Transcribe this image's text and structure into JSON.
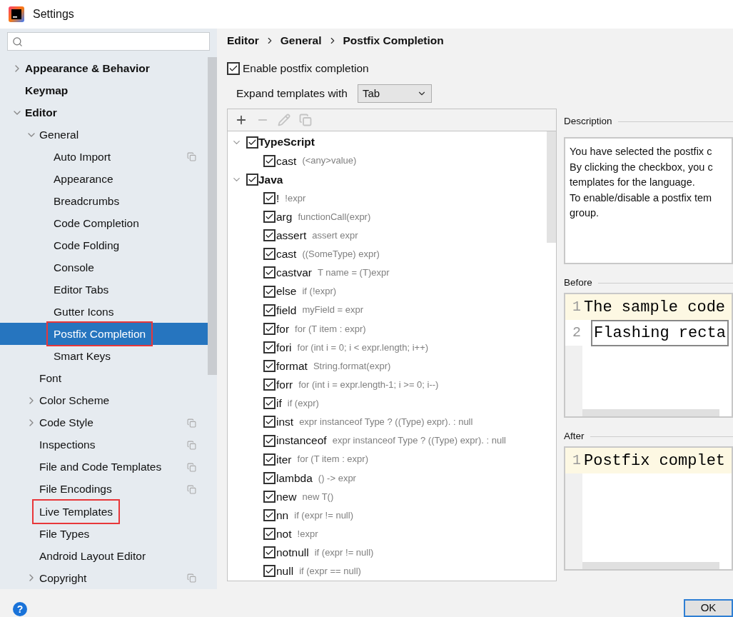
{
  "window": {
    "title": "Settings"
  },
  "sidebar": {
    "items": [
      {
        "label": "Appearance & Behavior",
        "expanded": false,
        "selected": false,
        "highlighted": false,
        "project_scope": false
      },
      {
        "label": "Keymap",
        "selected": false,
        "highlighted": false,
        "project_scope": false
      },
      {
        "label": "Editor",
        "expanded": true,
        "selected": false,
        "highlighted": false,
        "project_scope": false,
        "children": [
          {
            "label": "General",
            "expanded": true,
            "selected": false,
            "highlighted": false,
            "project_scope": false,
            "children": [
              {
                "label": "Auto Import",
                "selected": false,
                "highlighted": false,
                "project_scope": true
              },
              {
                "label": "Appearance",
                "selected": false,
                "highlighted": false,
                "project_scope": false
              },
              {
                "label": "Breadcrumbs",
                "selected": false,
                "highlighted": false,
                "project_scope": false
              },
              {
                "label": "Code Completion",
                "selected": false,
                "highlighted": false,
                "project_scope": false
              },
              {
                "label": "Code Folding",
                "selected": false,
                "highlighted": false,
                "project_scope": false
              },
              {
                "label": "Console",
                "selected": false,
                "highlighted": false,
                "project_scope": false
              },
              {
                "label": "Editor Tabs",
                "selected": false,
                "highlighted": false,
                "project_scope": false
              },
              {
                "label": "Gutter Icons",
                "selected": false,
                "highlighted": false,
                "project_scope": false
              },
              {
                "label": "Postfix Completion",
                "selected": true,
                "highlighted": true,
                "project_scope": false
              },
              {
                "label": "Smart Keys",
                "selected": false,
                "highlighted": false,
                "project_scope": false
              }
            ]
          },
          {
            "label": "Font",
            "selected": false,
            "highlighted": false,
            "project_scope": false
          },
          {
            "label": "Color Scheme",
            "expanded": false,
            "selected": false,
            "highlighted": false,
            "project_scope": false
          },
          {
            "label": "Code Style",
            "expanded": false,
            "selected": false,
            "highlighted": false,
            "project_scope": true
          },
          {
            "label": "Inspections",
            "selected": false,
            "highlighted": false,
            "project_scope": true
          },
          {
            "label": "File and Code Templates",
            "selected": false,
            "highlighted": false,
            "project_scope": true
          },
          {
            "label": "File Encodings",
            "selected": false,
            "highlighted": false,
            "project_scope": true
          },
          {
            "label": "Live Templates",
            "selected": false,
            "highlighted": true,
            "project_scope": false
          },
          {
            "label": "File Types",
            "selected": false,
            "highlighted": false,
            "project_scope": false
          },
          {
            "label": "Android Layout Editor",
            "selected": false,
            "highlighted": false,
            "project_scope": false
          },
          {
            "label": "Copyright",
            "expanded": false,
            "selected": false,
            "highlighted": false,
            "project_scope": true
          }
        ]
      }
    ]
  },
  "breadcrumb": [
    "Editor",
    "General",
    "Postfix Completion"
  ],
  "enable_checkbox": {
    "label": "Enable postfix completion",
    "checked": true
  },
  "expand_with": {
    "label": "Expand templates with",
    "value": "Tab"
  },
  "toolbar": [
    {
      "kind": "add",
      "disabled": false
    },
    {
      "kind": "remove",
      "disabled": true
    },
    {
      "kind": "edit",
      "disabled": true
    },
    {
      "kind": "copy",
      "disabled": true
    }
  ],
  "templates": [
    {
      "language": "TypeScript",
      "checked": true,
      "expanded": true,
      "children": [
        {
          "key": "cast",
          "example": "(<any>value)",
          "checked": true
        }
      ]
    },
    {
      "language": "Java",
      "checked": true,
      "expanded": true,
      "children": [
        {
          "key": "!",
          "example": "!expr",
          "checked": true
        },
        {
          "key": "arg",
          "example": "functionCall(expr)",
          "checked": true
        },
        {
          "key": "assert",
          "example": "assert expr",
          "checked": true
        },
        {
          "key": "cast",
          "example": "((SomeType) expr)",
          "checked": true
        },
        {
          "key": "castvar",
          "example": "T name = (T)expr",
          "checked": true
        },
        {
          "key": "else",
          "example": "if (!expr)",
          "checked": true
        },
        {
          "key": "field",
          "example": "myField = expr",
          "checked": true
        },
        {
          "key": "for",
          "example": "for (T item : expr)",
          "checked": true
        },
        {
          "key": "fori",
          "example": "for (int i = 0; i < expr.length; i++)",
          "checked": true
        },
        {
          "key": "format",
          "example": "String.format(expr)",
          "checked": true
        },
        {
          "key": "forr",
          "example": "for (int i = expr.length-1; i >= 0; i--)",
          "checked": true
        },
        {
          "key": "if",
          "example": "if (expr)",
          "checked": true
        },
        {
          "key": "inst",
          "example": "expr instanceof Type ? ((Type) expr). : null",
          "checked": true
        },
        {
          "key": "instanceof",
          "example": "expr instanceof Type ? ((Type) expr). : null",
          "checked": true
        },
        {
          "key": "iter",
          "example": "for (T item : expr)",
          "checked": true
        },
        {
          "key": "lambda",
          "example": "() -> expr",
          "checked": true
        },
        {
          "key": "new",
          "example": "new T()",
          "checked": true
        },
        {
          "key": "nn",
          "example": "if (expr != null)",
          "checked": true
        },
        {
          "key": "not",
          "example": "!expr",
          "checked": true
        },
        {
          "key": "notnull",
          "example": "if (expr != null)",
          "checked": true
        },
        {
          "key": "null",
          "example": "if (expr == null)",
          "checked": true
        }
      ]
    }
  ],
  "description": {
    "title": "Description",
    "lines": [
      "You have selected the postfix c",
      "By clicking the checkbox, you c",
      "templates for the language.",
      "To enable/disable a postfix tem",
      "group."
    ]
  },
  "before": {
    "title": "Before",
    "lines": [
      {
        "number": "1",
        "text": "The sample code",
        "caret": false
      },
      {
        "number": "2",
        "text": "Flashing recta",
        "caret": true
      }
    ]
  },
  "after": {
    "title": "After",
    "lines": [
      {
        "number": "1",
        "text": "Postfix complet",
        "caret": false
      }
    ]
  },
  "footer": {
    "help": "?",
    "ok": "OK"
  }
}
